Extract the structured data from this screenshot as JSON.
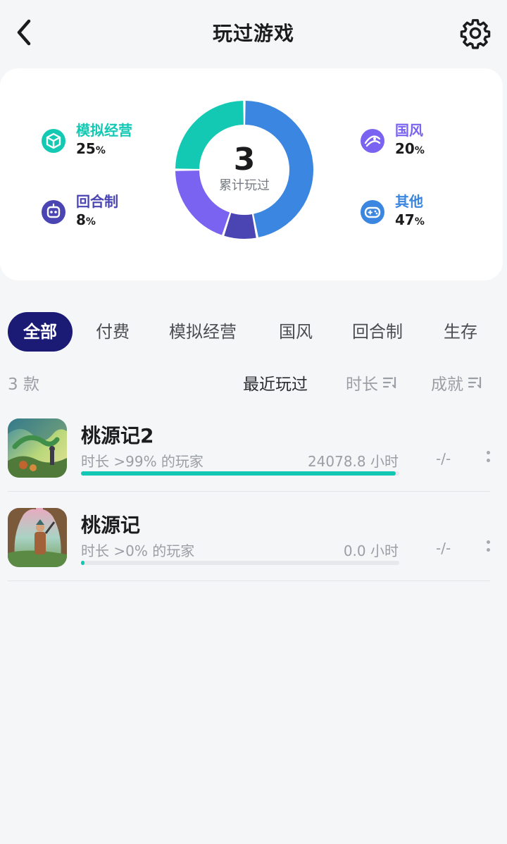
{
  "header": {
    "title": "玩过游戏"
  },
  "summary": {
    "total": "3",
    "total_label": "累计玩过",
    "categories": [
      {
        "name": "模拟经营",
        "percent": 25,
        "pct_value": "25",
        "pct_unit": "%",
        "color": "#13c9b3",
        "icon": "cube-icon"
      },
      {
        "name": "回合制",
        "percent": 8,
        "pct_value": "8",
        "pct_unit": "%",
        "color": "#4b45b4",
        "icon": "robot-icon"
      },
      {
        "name": "国风",
        "percent": 20,
        "pct_value": "20",
        "pct_unit": "%",
        "color": "#7a63f0",
        "icon": "fan-icon"
      },
      {
        "name": "其他",
        "percent": 47,
        "pct_value": "47",
        "pct_unit": "%",
        "color": "#3b86e0",
        "icon": "gamepad-icon"
      }
    ]
  },
  "tabs": [
    "全部",
    "付费",
    "模拟经营",
    "国风",
    "回合制",
    "生存"
  ],
  "active_tab": "全部",
  "sortbar": {
    "count": "3 款",
    "options": [
      "最近玩过",
      "时长",
      "成就"
    ],
    "active": "最近玩过"
  },
  "games": [
    {
      "name": "桃源记2",
      "rank_text": "时长 >99% 的玩家",
      "hours": "24078.8 小时",
      "progress": 0.99,
      "achievement": "-/-"
    },
    {
      "name": "桃源记",
      "rank_text": "时长 >0% 的玩家",
      "hours": "0.0 小时",
      "progress": 0.01,
      "achievement": "-/-"
    }
  ],
  "colors": {
    "accent": "#12c7b4",
    "tab_active_bg": "#1b1a74"
  }
}
